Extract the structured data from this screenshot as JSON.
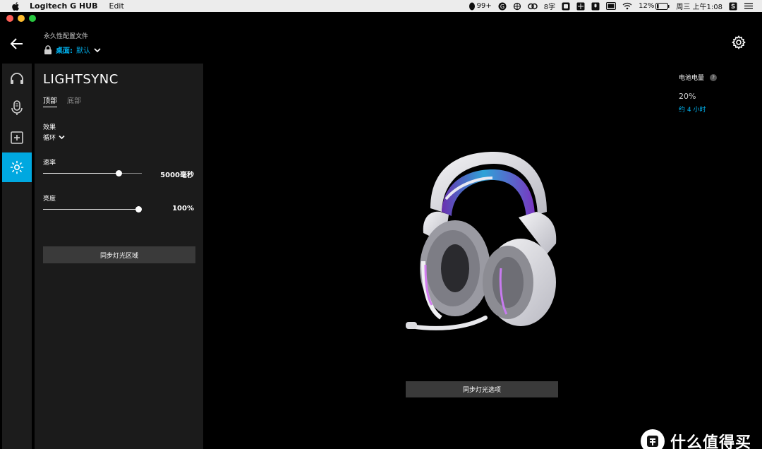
{
  "menubar": {
    "app_name": "Logitech G HUB",
    "edit": "Edit",
    "qq_count": "99+",
    "input_status": "8字",
    "battery": "12%",
    "clock": "周三 上午1:08"
  },
  "header": {
    "profile_caption": "永久性配置文件",
    "profile_prefix": "桌面:",
    "profile_name": "默认"
  },
  "panel": {
    "title": "LIGHTSYNC",
    "tabs": [
      "顶部",
      "底部"
    ],
    "effect_label": "效果",
    "effect_value": "循环",
    "speed_label": "速率",
    "speed_value": "5000毫秒",
    "speed_fraction": 0.77,
    "brightness_label": "亮度",
    "brightness_value": "100%",
    "brightness_fraction": 0.97,
    "sync_zone_button": "同步灯光区域"
  },
  "battery": {
    "label": "电池电量",
    "help": "?",
    "percent": "20%",
    "remaining": "约 4 小时"
  },
  "sync_options_button": "同步灯光选项",
  "watermark": {
    "logo_char": "值",
    "text": "什么值得买"
  },
  "colors": {
    "accent": "#00b3f0",
    "active_rail": "#00a8e0",
    "panel_bg": "#1b1b1b",
    "button_bg": "#3a3a3a"
  }
}
